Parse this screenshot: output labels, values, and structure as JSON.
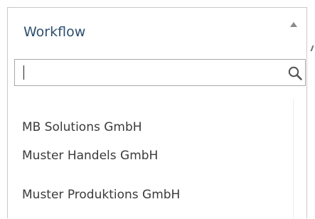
{
  "select": {
    "selected_label": "Workflow",
    "caret_icon": "caret-up-icon"
  },
  "search": {
    "value": "",
    "placeholder": "",
    "icon": "search-icon"
  },
  "options": [
    {
      "label": "MB Solutions GmbH"
    },
    {
      "label": "Muster Handels GmbH"
    },
    {
      "label": "Muster Produktions GmbH"
    }
  ],
  "colors": {
    "selected_text": "#2d4f6e",
    "option_text": "#3a3a3a",
    "border": "#c9c9c9",
    "search_border": "#a8a8a8"
  }
}
